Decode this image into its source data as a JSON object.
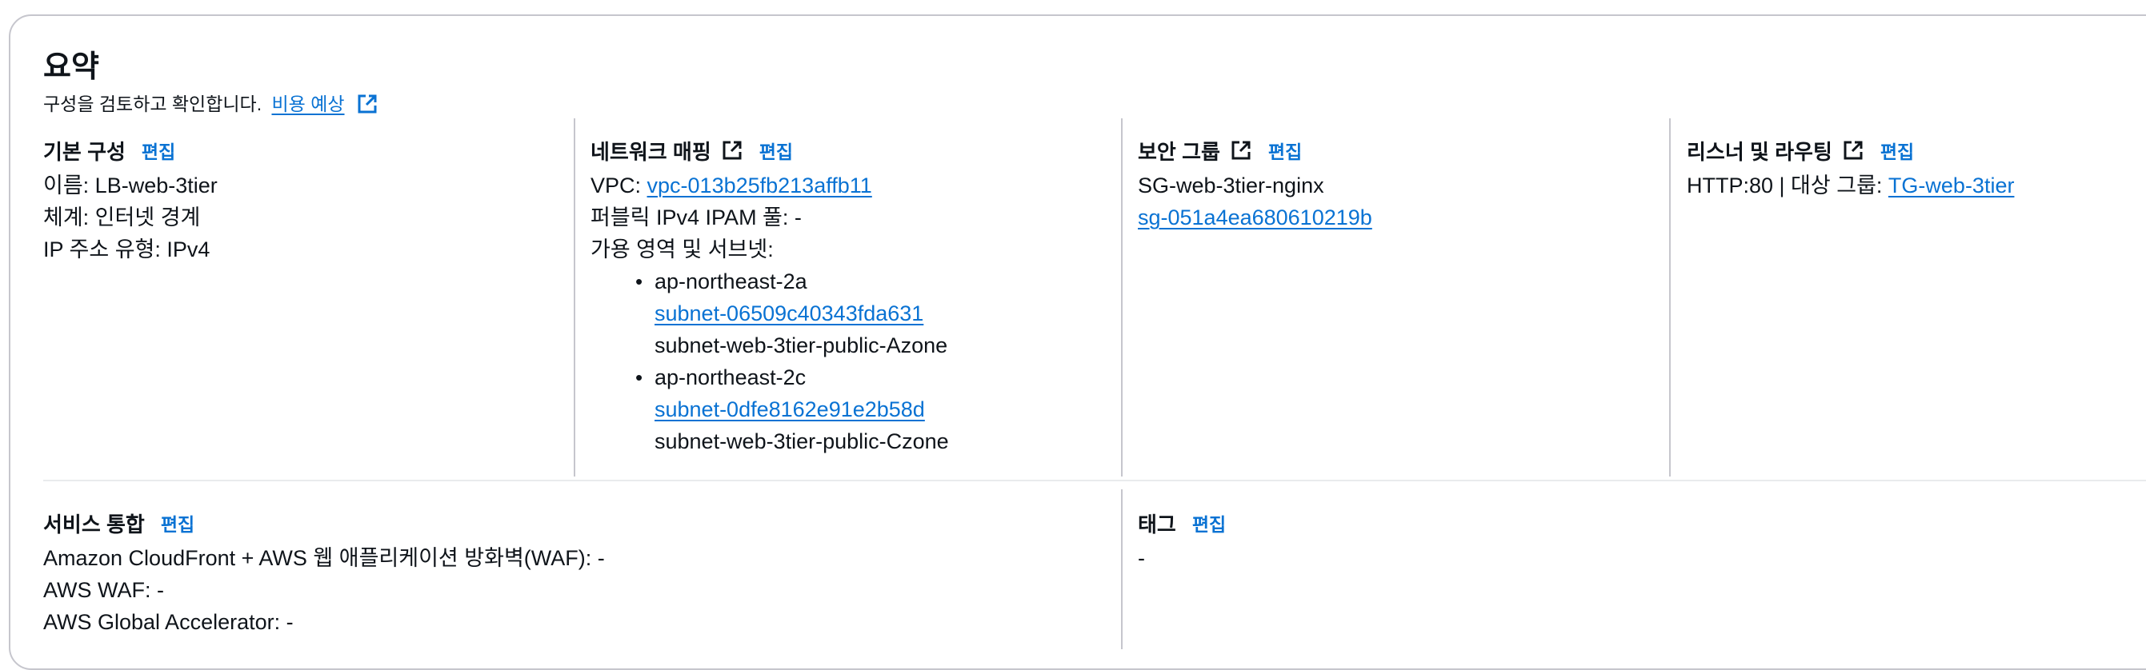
{
  "summary": {
    "title": "요약",
    "subtitle": "구성을 검토하고 확인합니다.",
    "cost_link": "비용 예상"
  },
  "edit_label": "편집",
  "basic": {
    "header": "기본 구성",
    "name": "이름: LB-web-3tier",
    "scheme": "체계: 인터넷 경계",
    "ip_type": "IP 주소 유형: IPv4"
  },
  "network": {
    "header": "네트워크 매핑",
    "vpc_label": "VPC: ",
    "vpc_link": "vpc-013b25fb213affb11",
    "ipam": "퍼블릭 IPv4 IPAM 풀: -",
    "az_label": "가용 영역 및 서브넷:",
    "azs": [
      {
        "zone": "ap-northeast-2a",
        "subnet_id": "subnet-06509c40343fda631",
        "subnet_name": "subnet-web-3tier-public-Azone"
      },
      {
        "zone": "ap-northeast-2c",
        "subnet_id": "subnet-0dfe8162e91e2b58d",
        "subnet_name": "subnet-web-3tier-public-Czone"
      }
    ]
  },
  "security": {
    "header": "보안 그룹",
    "name": "SG-web-3tier-nginx",
    "sg_link": "sg-051a4ea680610219b"
  },
  "listener": {
    "header": "리스너 및 라우팅",
    "prefix": "HTTP:80 | 대상 그룹: ",
    "tg_link": "TG-web-3tier"
  },
  "integration": {
    "header": "서비스 통합",
    "cloudfront": "Amazon CloudFront + AWS 웹 애플리케이션 방화벽(WAF): -",
    "waf": "AWS WAF: -",
    "accelerator": "AWS Global Accelerator: -"
  },
  "tags": {
    "header": "태그",
    "value": "-"
  },
  "colors": {
    "link": "#0972d3",
    "text": "#0f141a",
    "border": "#c6c6cd"
  }
}
